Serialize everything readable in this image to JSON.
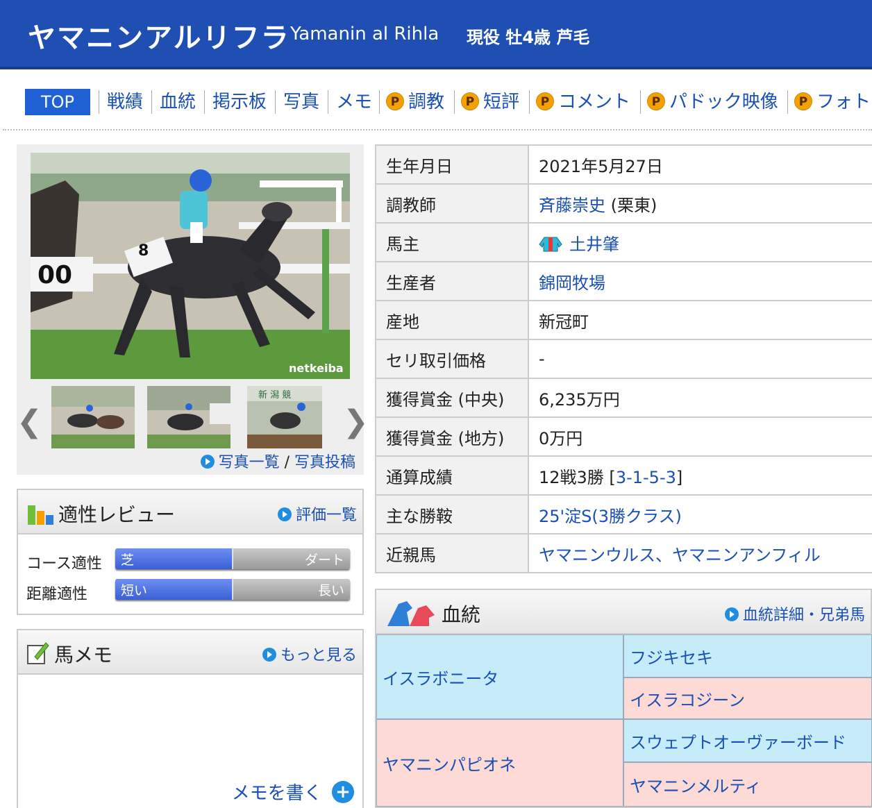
{
  "header": {
    "name_jp": "ヤマニンアルリフラ",
    "name_en": "Yamanin al Rihla",
    "status": "現役 牡4歳 芦毛"
  },
  "nav": [
    {
      "label": "TOP",
      "premium": false
    },
    {
      "label": "戦績",
      "premium": false
    },
    {
      "label": "血統",
      "premium": false
    },
    {
      "label": "掲示板",
      "premium": false
    },
    {
      "label": "写真",
      "premium": false
    },
    {
      "label": "メモ",
      "premium": false
    },
    {
      "label": "調教",
      "premium": true
    },
    {
      "label": "短評",
      "premium": true
    },
    {
      "label": "コメント",
      "premium": true
    },
    {
      "label": "パドック映像",
      "premium": true
    },
    {
      "label": "フォト",
      "premium": true
    }
  ],
  "premium_badge": "P",
  "photo": {
    "watermark": "netkeiba",
    "saddle_number": "8",
    "thumb3_sign": "新 潟 競",
    "prev": "❮",
    "next": "❯",
    "link_list": "写真一覧",
    "link_sep": " / ",
    "link_post": "写真投稿"
  },
  "aptitude": {
    "title": "適性レビュー",
    "link": "評価一覧",
    "rows": [
      {
        "label": "コース適性",
        "left": "芝",
        "right": "ダート",
        "level_percent": 50
      },
      {
        "label": "距離適性",
        "left": "短い",
        "right": "長い",
        "level_percent": 50
      }
    ]
  },
  "memo": {
    "title": "馬メモ",
    "link": "もっと見る",
    "write": "メモを書く",
    "plus": "+"
  },
  "info": {
    "birth_label": "生年月日",
    "birth": "2021年5月27日",
    "trainer_label": "調教師",
    "trainer": "斉藤崇史",
    "trainer_suffix": " (栗東)",
    "owner_label": "馬主",
    "owner": "土井肇",
    "breeder_label": "生産者",
    "breeder": "錦岡牧場",
    "origin_label": "産地",
    "origin": "新冠町",
    "auction_label": "セリ取引価格",
    "auction": "-",
    "earn_central_label": "獲得賞金 (中央)",
    "earn_central": "6,235万円",
    "earn_local_label": "獲得賞金 (地方)",
    "earn_local": "0万円",
    "record_label": "通算成績",
    "record_prefix": "12戦3勝 [",
    "record_link": "3-1-5-3",
    "record_suffix": "]",
    "wins_label": "主な勝鞍",
    "wins": "25'淀S(3勝クラス)",
    "relatives_label": "近親馬",
    "relatives": "ヤマニンウルス、ヤマニンアンフィル"
  },
  "pedigree": {
    "title": "血統",
    "link": "血統詳細・兄弟馬",
    "sire": "イスラボニータ",
    "dam": "ヤマニンパピオネ",
    "sire_sire": "フジキセキ",
    "sire_dam": "イスラコジーン",
    "dam_sire": "スウェプトオーヴァーボード",
    "dam_dam": "ヤマニンメルティ"
  },
  "colors": {
    "header_bg": "#1f4fb3",
    "link": "#1a4fb5",
    "premium": "#f2a100",
    "sire_bg": "#c6ecfa",
    "dam_bg": "#fddad5"
  }
}
